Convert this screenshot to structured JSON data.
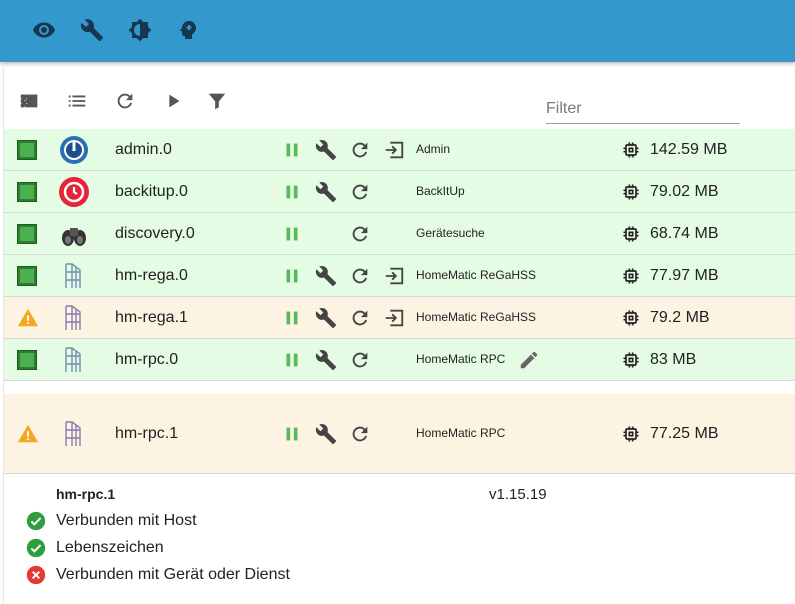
{
  "topbar": {
    "buttons": [
      "eye-icon",
      "wrench-icon",
      "brightness-icon",
      "head-icon"
    ],
    "color": "#3399cc"
  },
  "toolbar": {
    "icons": [
      "view-module-icon",
      "view-list-icon",
      "refresh-icon",
      "play-icon",
      "filter-icon"
    ],
    "filter_placeholder": "Filter"
  },
  "instances": [
    {
      "status": "running",
      "name": "admin.0",
      "title": "Admin",
      "memory": "142.59 MB"
    },
    {
      "status": "running",
      "name": "backitup.0",
      "title": "BackItUp",
      "memory": "79.02 MB"
    },
    {
      "status": "running",
      "name": "discovery.0",
      "title": "Gerätesuche",
      "memory": "68.74 MB"
    },
    {
      "status": "running",
      "name": "hm-rega.0",
      "title": "HomeMatic ReGaHSS",
      "memory": "77.97 MB"
    },
    {
      "status": "warning",
      "name": "hm-rega.1",
      "title": "HomeMatic ReGaHSS",
      "memory": "79.2 MB"
    },
    {
      "status": "running",
      "name": "hm-rpc.0",
      "title": "HomeMatic RPC",
      "memory": "83 MB"
    },
    {
      "status": "warning",
      "name": "hm-rpc.1",
      "title": "HomeMatic RPC",
      "memory": "77.25 MB"
    }
  ],
  "detail": {
    "name": "hm-rpc.1",
    "version": "v1.15.19",
    "checks": [
      {
        "label": "Verbunden mit Host",
        "ok": true
      },
      {
        "label": "Lebenszeichen",
        "ok": true
      },
      {
        "label": "Verbunden mit Gerät oder Dienst",
        "ok": false
      }
    ]
  },
  "colors": {
    "row_ok": "#e3fce3",
    "row_warn": "#fdf3e2",
    "running_green": "#4caf50",
    "warning_orange": "#f5a623",
    "error_red": "#e53935"
  }
}
